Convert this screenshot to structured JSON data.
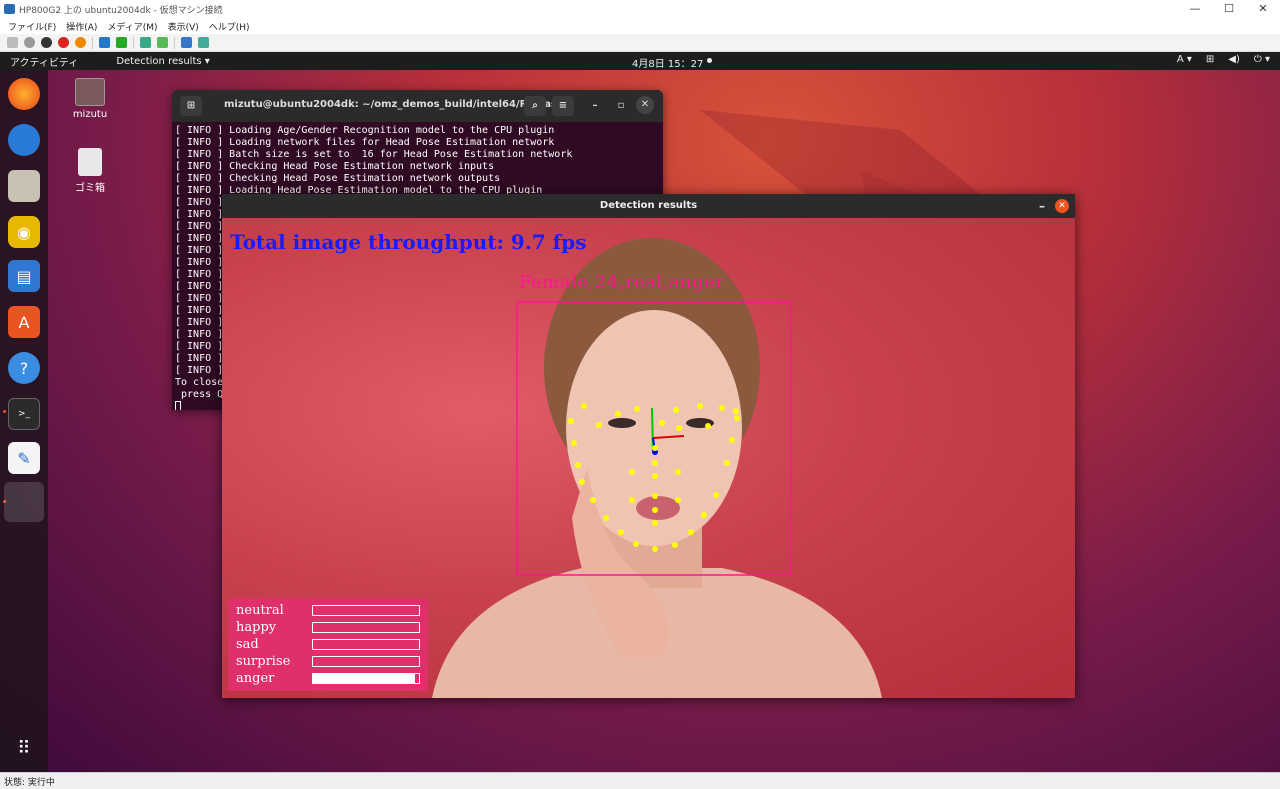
{
  "host": {
    "title": "HP800G2 上の ubuntu2004dk - 仮想マシン接続",
    "menu": [
      "ファイル(F)",
      "操作(A)",
      "メディア(M)",
      "表示(V)",
      "ヘルプ(H)"
    ],
    "status": "状態: 実行中"
  },
  "topbar": {
    "activities": "アクティビティ",
    "app_menu": "Detection results ▾",
    "clock": "4月8日 15：27",
    "input_method": "A ▾"
  },
  "desktop": {
    "icons": [
      {
        "label": "mizutu"
      },
      {
        "label": "ゴミ箱"
      }
    ]
  },
  "terminal": {
    "title": "mizutu@ubuntu2004dk: ~/omz_demos_build/intel64/Release",
    "lines": [
      "[ INFO ] Loading Age/Gender Recognition model to the CPU plugin",
      "[ INFO ] Loading network files for Head Pose Estimation network",
      "[ INFO ] Batch size is set to  16 for Head Pose Estimation network",
      "[ INFO ] Checking Head Pose Estimation network inputs",
      "[ INFO ] Checking Head Pose Estimation network outputs",
      "[ INFO ] Loading Head Pose Estimation model to the CPU plugin",
      "[ INFO ]",
      "[ INFO ]",
      "[ INFO ]",
      "[ INFO ]",
      "[ INFO ]",
      "[ INFO ]",
      "[ INFO ]",
      "[ INFO ]",
      "[ INFO ]",
      "[ INFO ]",
      "[ INFO ]",
      "[ INFO ]",
      "[ INFO ]",
      "[ INFO ]",
      "[ INFO ]",
      "To close",
      " press Q"
    ]
  },
  "detection": {
    "window_title": "Detection results",
    "fps_text": "Total image throughput: 9.7 fps",
    "face_label": "Female,24,real,anger",
    "emotions": [
      {
        "label": "neutral",
        "level": 0.0
      },
      {
        "label": "happy",
        "level": 0.0
      },
      {
        "label": "sad",
        "level": 0.0
      },
      {
        "label": "surprise",
        "level": 0.0
      },
      {
        "label": "anger",
        "level": 0.96
      }
    ]
  },
  "colors": {
    "fps_text": "#1a1aff",
    "face_box": "#ff1493",
    "landmarks": "#ffff00",
    "emotion_panel": "#e0306c",
    "ubuntu_orange": "#e95420"
  }
}
